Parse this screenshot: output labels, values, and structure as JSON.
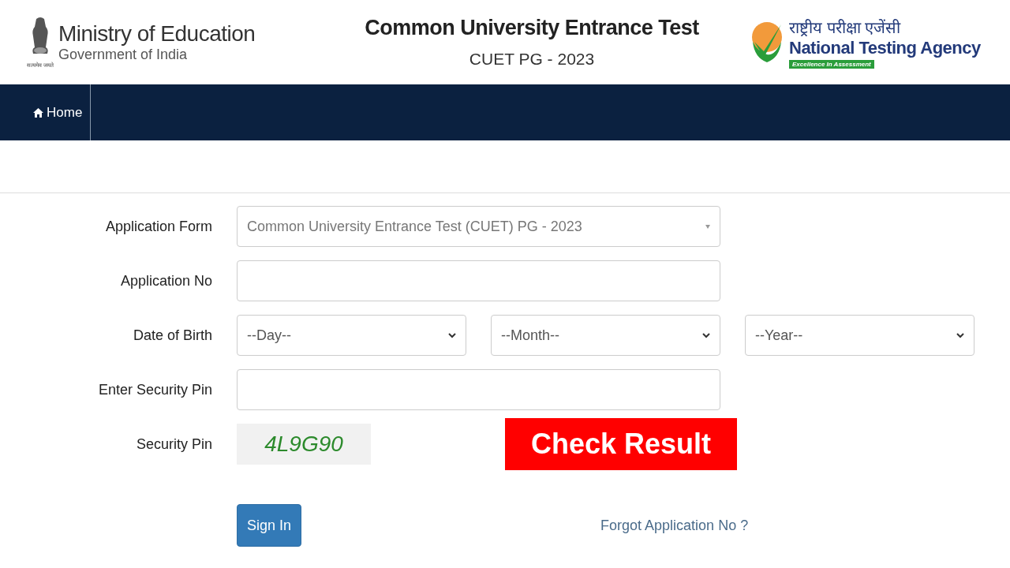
{
  "header": {
    "emblem_caption": "सत्यमेव जयते",
    "ministry_title": "Ministry of Education",
    "ministry_subtitle": "Government of India",
    "exam_title": "Common University Entrance Test",
    "exam_subtitle": "CUET PG - 2023",
    "agency_hindi": "राष्ट्रीय परीक्षा एजेंसी",
    "agency_name": "National Testing Agency",
    "agency_tagline": "Excellence In Assessment"
  },
  "nav": {
    "items": [
      {
        "label": "Home"
      }
    ]
  },
  "form": {
    "rows": [
      {
        "kind": "select",
        "label": "Application Form",
        "value": "Common University Entrance Test (CUET) PG - 2023"
      },
      {
        "kind": "text",
        "label": "Application No"
      },
      {
        "kind": "date",
        "label": "Date of Birth",
        "selects": [
          "--Day--",
          "--Month--",
          "--Year--"
        ]
      },
      {
        "kind": "text",
        "label": "Enter Security Pin"
      },
      {
        "kind": "captcha",
        "label": "Security Pin",
        "value": "4L9G90"
      }
    ],
    "sign_in": "Sign In",
    "forgot_link": "Forgot Application No ?"
  },
  "banner": "Check Result"
}
